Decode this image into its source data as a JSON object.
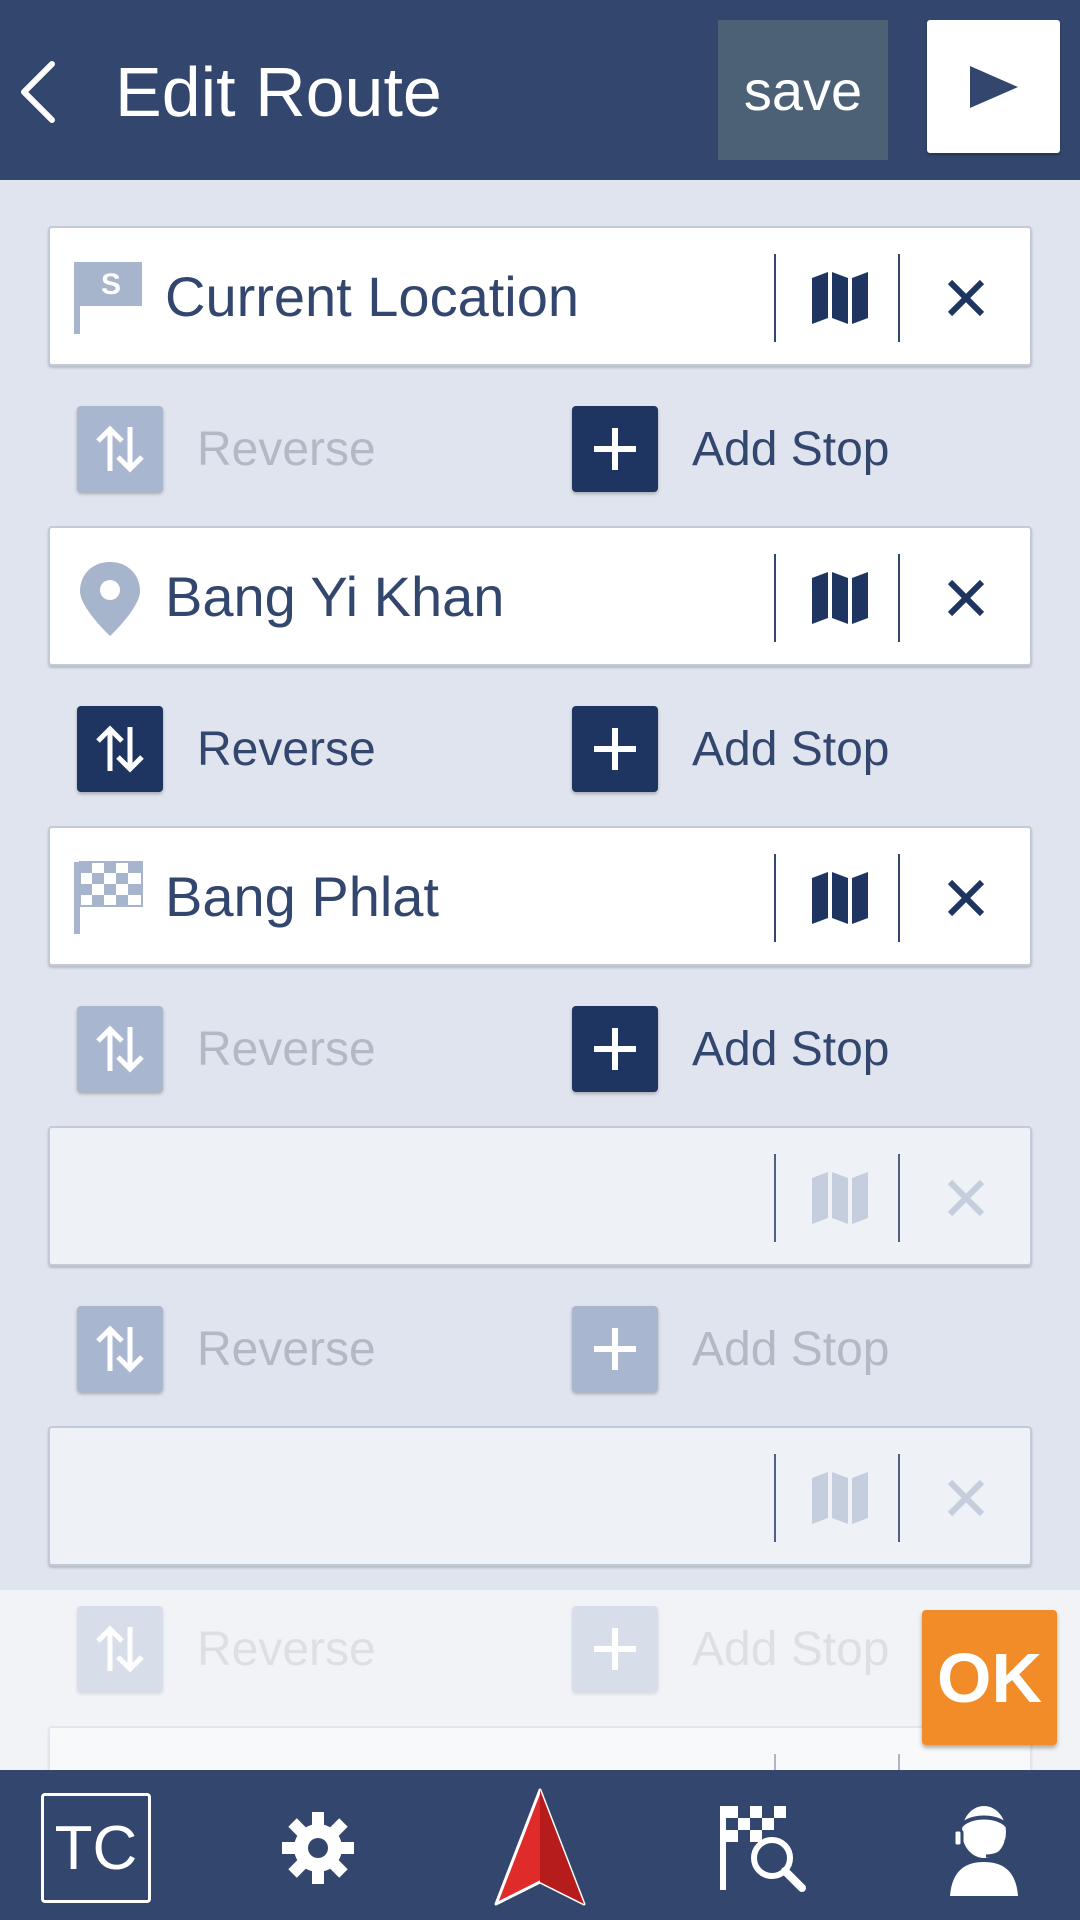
{
  "header": {
    "title": "Edit Route",
    "save_label": "save"
  },
  "route": {
    "stops": [
      {
        "name": "Current Location",
        "icon": "start-flag-icon",
        "start_badge": "S"
      },
      {
        "name": "Bang Yi Khan",
        "icon": "location-pin-icon"
      },
      {
        "name": "Bang Phlat",
        "icon": "checkered-flag-icon"
      },
      {
        "name": "",
        "icon": ""
      },
      {
        "name": "",
        "icon": ""
      }
    ],
    "actions": [
      {
        "reverse_label": "Reverse",
        "add_label": "Add Stop"
      },
      {
        "reverse_label": "Reverse",
        "add_label": "Add Stop"
      },
      {
        "reverse_label": "Reverse",
        "add_label": "Add Stop"
      },
      {
        "reverse_label": "Reverse",
        "add_label": "Add Stop"
      },
      {
        "reverse_label": "Reverse",
        "add_label": "Add Stop"
      }
    ]
  },
  "ok_label": "OK",
  "bottom_nav": {
    "tc_label": "TC",
    "items": [
      "tc-icon",
      "gear-icon",
      "navigation-arrow-icon",
      "route-search-icon",
      "support-agent-icon"
    ]
  },
  "colors": {
    "header_bg": "#33476e",
    "accent_orange": "#f28c28",
    "dark_button": "#1f3561",
    "faded_button": "#a8b6cf",
    "page_bg": "#dfe4ee"
  }
}
